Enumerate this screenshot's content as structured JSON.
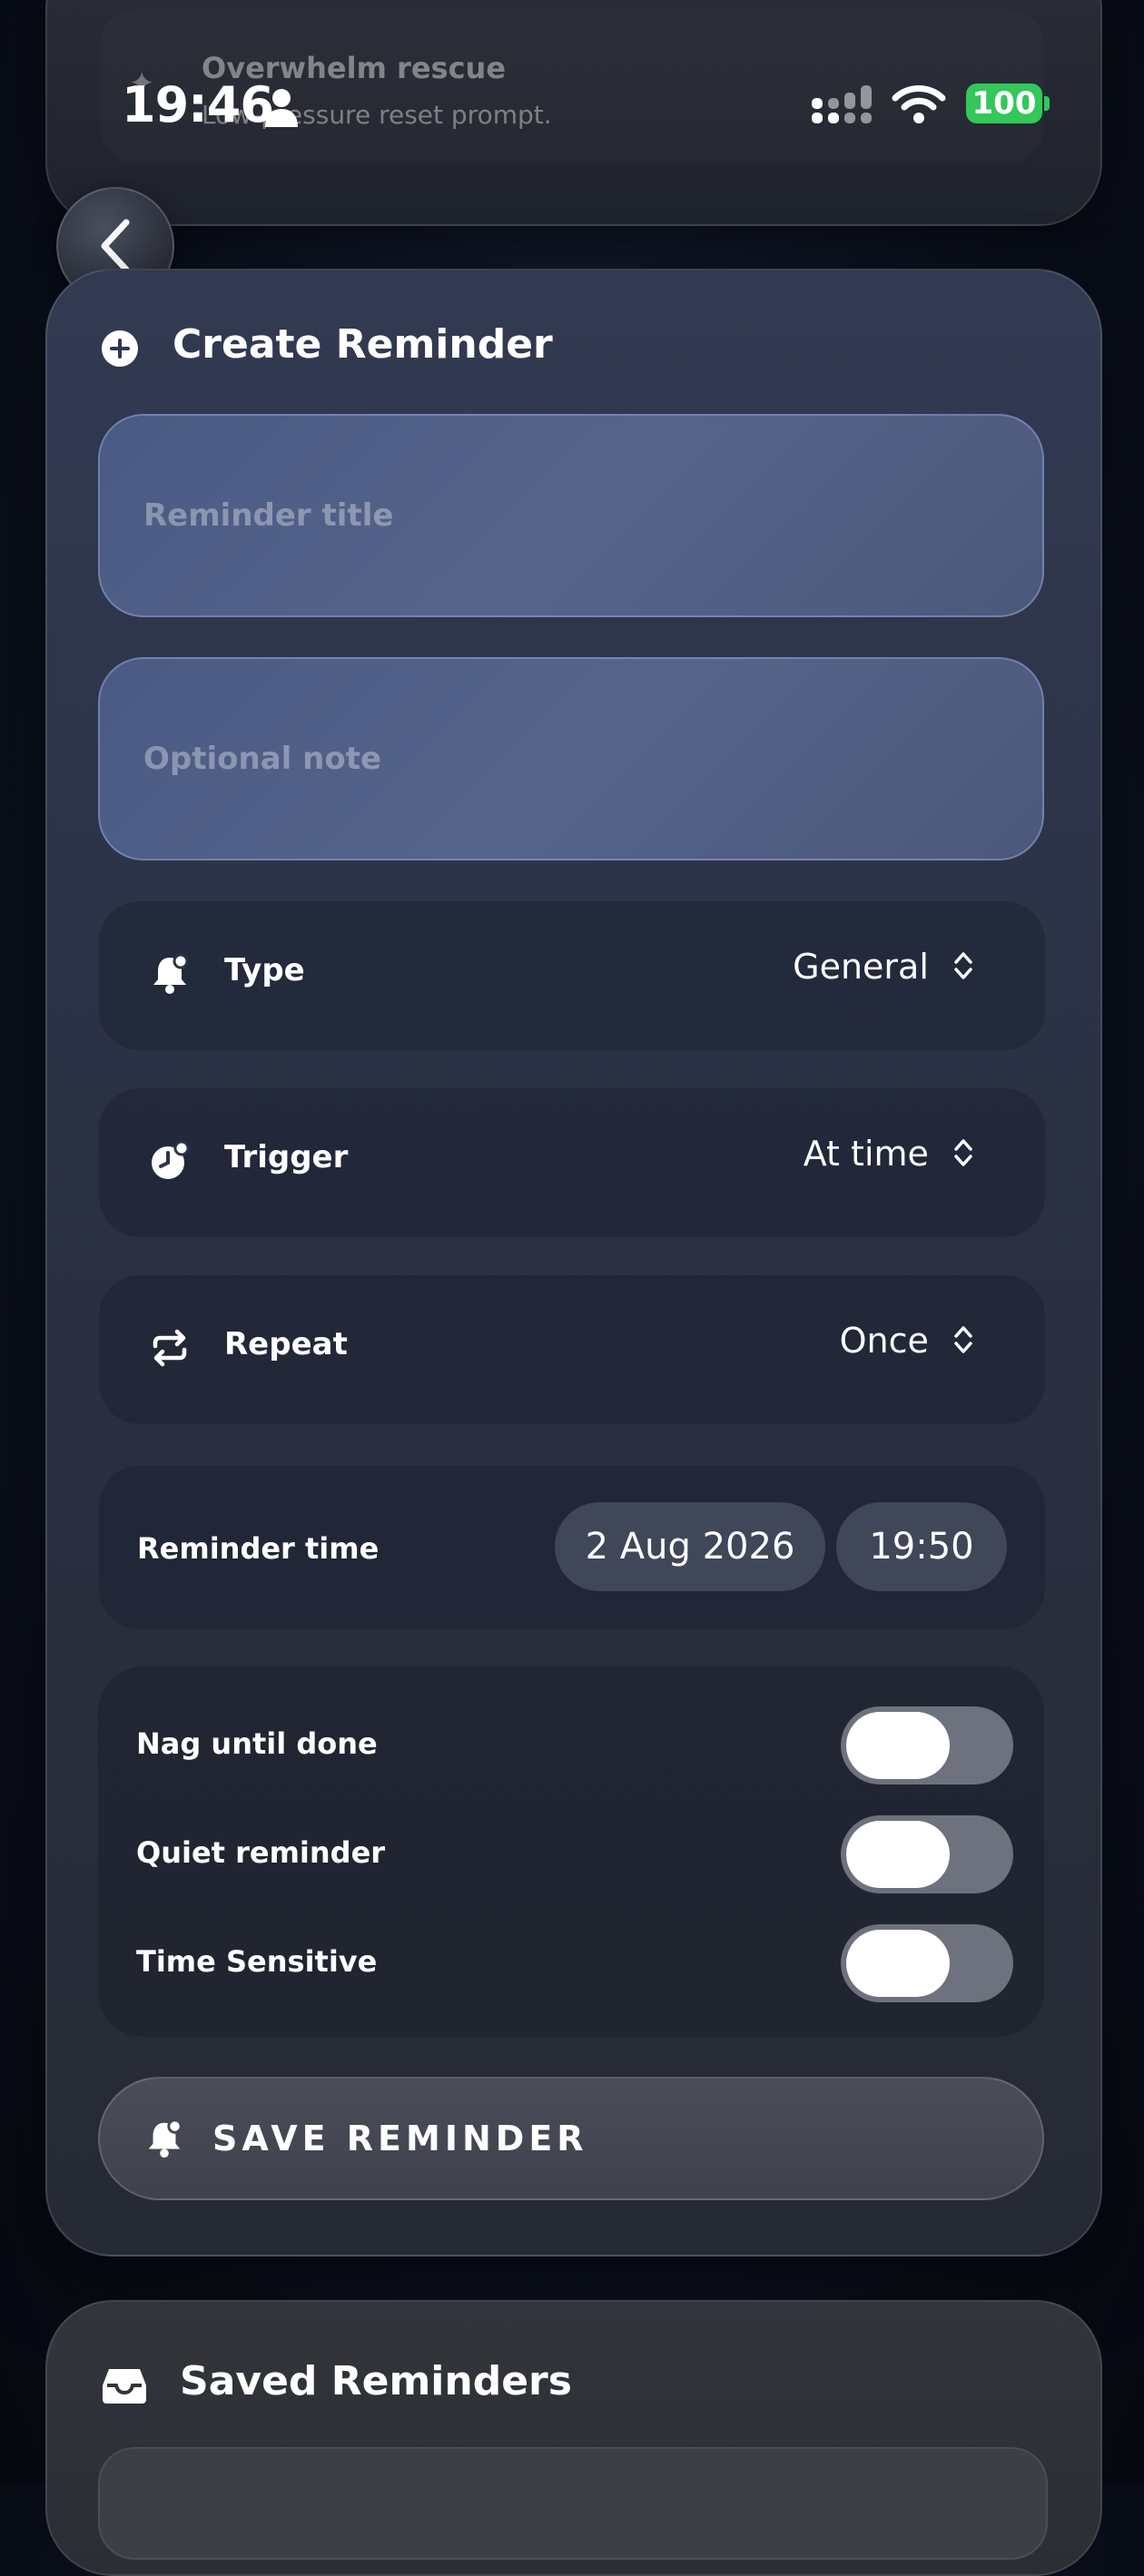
{
  "status_bar": {
    "time": "19:46",
    "battery": "100"
  },
  "previous_card": {
    "title": "Overwhelm rescue",
    "subtitle": "Low-pressure reset prompt."
  },
  "create_reminder": {
    "title": "Create Reminder",
    "title_placeholder": "Reminder title",
    "note_placeholder": "Optional note",
    "type": {
      "label": "Type",
      "value": "General"
    },
    "trigger": {
      "label": "Trigger",
      "value": "At time"
    },
    "repeat": {
      "label": "Repeat",
      "value": "Once"
    },
    "reminder_time": {
      "label": "Reminder time",
      "date": "2 Aug 2026",
      "time": "19:50"
    },
    "toggles": [
      {
        "label": "Nag until done",
        "on": false
      },
      {
        "label": "Quiet reminder",
        "on": false
      },
      {
        "label": "Time Sensitive",
        "on": false
      }
    ],
    "save_label": "SAVE REMINDER"
  },
  "saved_reminders": {
    "title": "Saved Reminders"
  },
  "colors": {
    "battery": "#34c759",
    "switch_off": "#6d727e",
    "field": "#56648c"
  }
}
